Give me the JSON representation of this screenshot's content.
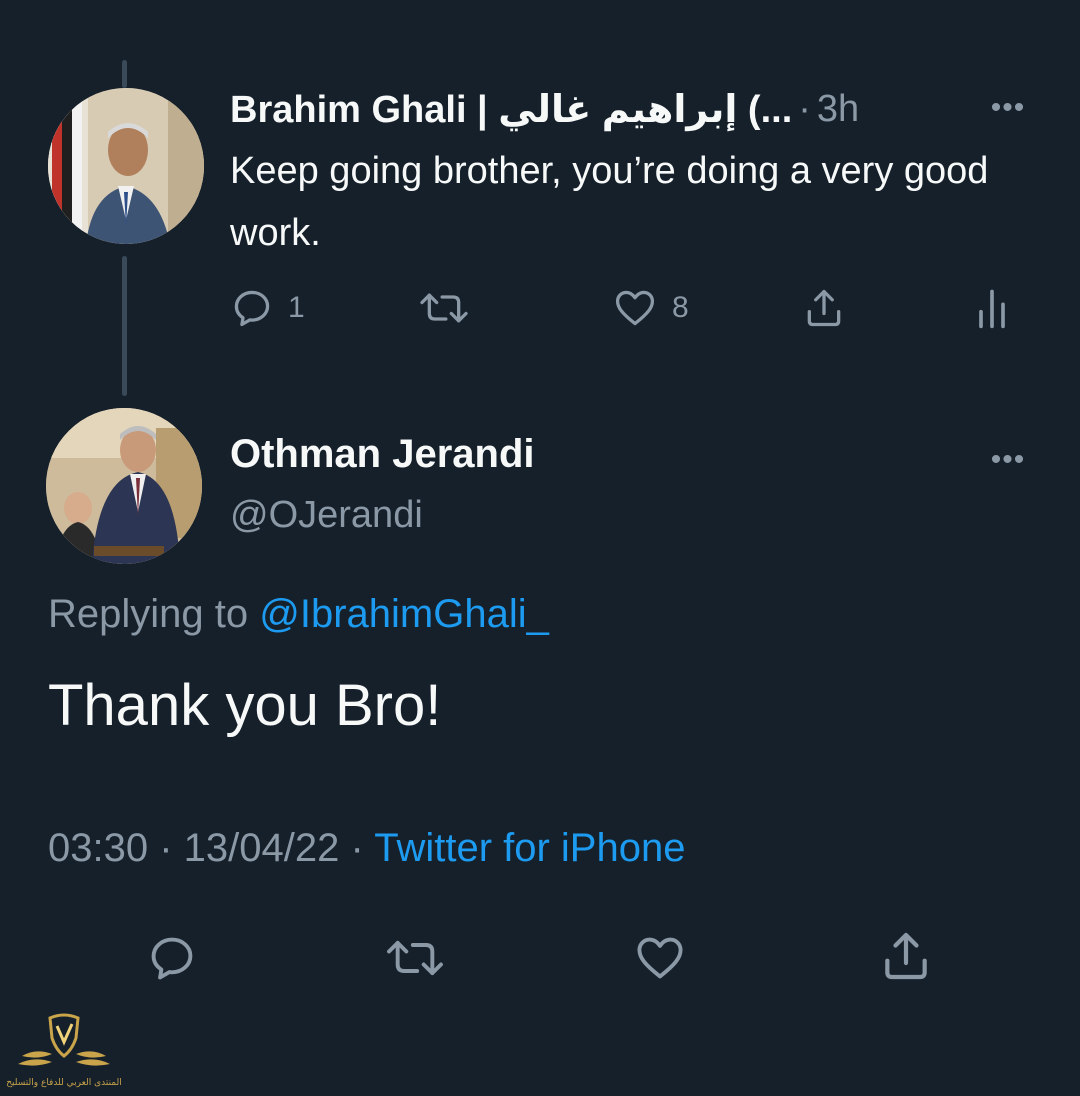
{
  "reply_tweet": {
    "author": "Brahim Ghali | إبراهيم غالي (...",
    "time": "3h",
    "text": "Keep going brother, you’re doing a very good work.",
    "actions": {
      "reply_count": "1",
      "retweet_count": "",
      "like_count": "8"
    },
    "icons": [
      "reply-icon",
      "retweet-icon",
      "heart-icon",
      "share-icon",
      "analytics-icon",
      "more-icon"
    ]
  },
  "main_tweet": {
    "author": "Othman Jerandi",
    "handle": "@OJerandi",
    "replying_prefix": "Replying to",
    "replying_to": "@IbrahimGhali_",
    "text": "Thank you Bro!",
    "time": "03:30",
    "date": "13/04/22",
    "source": "Twitter for iPhone",
    "icons": [
      "reply-icon",
      "retweet-icon",
      "heart-icon",
      "share-icon",
      "more-icon"
    ]
  },
  "watermark": {
    "text": "المنتدى العربي للدفاع والتسليح"
  },
  "colors": {
    "background": "#15202b",
    "text": "#f7f9f9",
    "muted": "#8b98a5",
    "link": "#1d9bf0",
    "thread_line": "#3a4a58"
  }
}
